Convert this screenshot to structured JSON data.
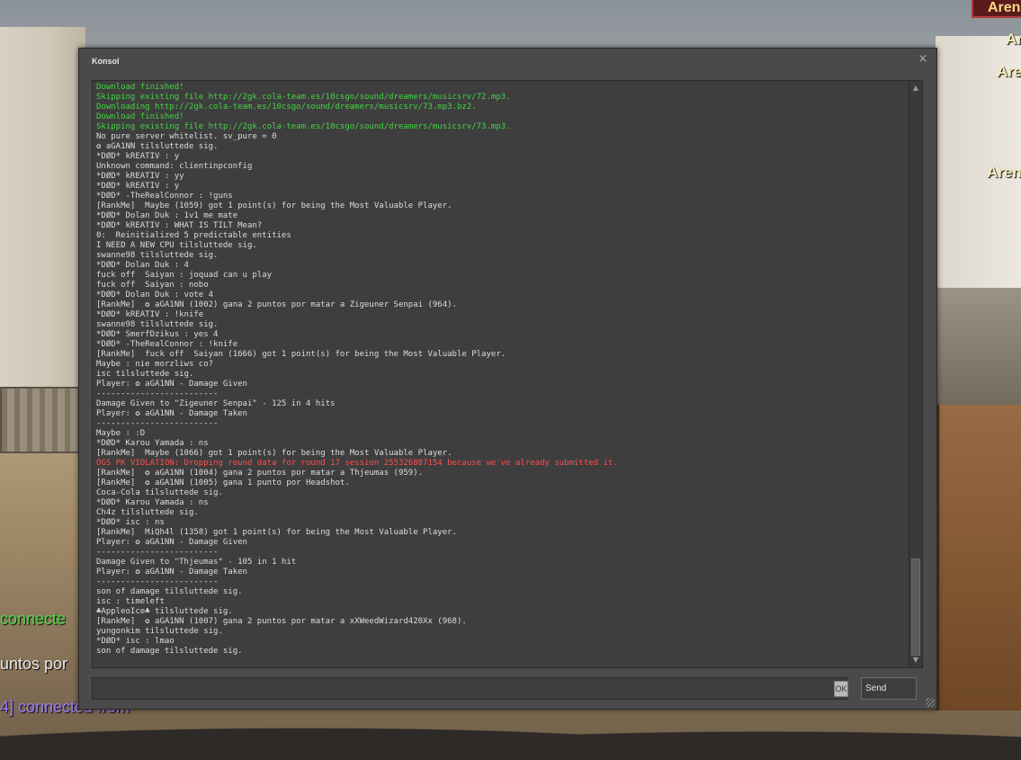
{
  "hud": {
    "top_right": "Arena",
    "arena_labels": [
      "Ar",
      "Are",
      "Aren"
    ],
    "chat": [
      {
        "text": "connecte",
        "color": "#4fd64f"
      },
      {
        "text": "untos por",
        "color": "#e8e8e8"
      },
      {
        "text": "4] connected from",
        "color": "#9b7cff"
      }
    ]
  },
  "window": {
    "title": "Konsol",
    "close_glyph": "×"
  },
  "colors": {
    "normal": "#dcdcdc",
    "download": "#42d642",
    "error": "#ff4d4d"
  },
  "log": [
    {
      "text": "Download finished!",
      "type": "green"
    },
    {
      "text": "Skipping existing file http://2gk.cola-team.es/10csgo/sound/dreamers/musicsrv/72.mp3.",
      "type": "green"
    },
    {
      "text": "Downloading http://2gk.cola-team.es/10csgo/sound/dreamers/musicsrv/73.mp3.bz2.",
      "type": "green"
    },
    {
      "text": "Download finished!",
      "type": "green"
    },
    {
      "text": "Skipping existing file http://2gk.cola-team.es/10csgo/sound/dreamers/musicsrv/73.mp3.",
      "type": "green"
    },
    {
      "text": "No pure server whitelist. sv_pure = 0",
      "type": "white"
    },
    {
      "text": "✪ aGA1NN tilsluttede sig.",
      "type": "white"
    },
    {
      "text": "*DØD* kREATIV : y",
      "type": "white"
    },
    {
      "text": "Unknown command: clientinpconfig",
      "type": "white"
    },
    {
      "text": "*DØD* kREATIV : yy",
      "type": "white"
    },
    {
      "text": "*DØD* kREATIV : y",
      "type": "white"
    },
    {
      "text": "*DØD* -TheRealConnor : !guns",
      "type": "white"
    },
    {
      "text": "[RankMe]  Maybe (1059) got 1 point(s) for being the Most Valuable Player.",
      "type": "white"
    },
    {
      "text": "*DØD* Dolan Duk : 1v1 me mate",
      "type": "white"
    },
    {
      "text": "*DØD* kREATIV : WHAT IS TILT Mean?",
      "type": "white"
    },
    {
      "text": "0:  Reinitialized 5 predictable entities",
      "type": "white"
    },
    {
      "text": "I NEED A NEW CPU tilsluttede sig.",
      "type": "white"
    },
    {
      "text": "swanne98 tilsluttede sig.",
      "type": "white"
    },
    {
      "text": "*DØD* Dolan Duk : 4",
      "type": "white"
    },
    {
      "text": "fuck off  Saiyan : joquad can u play",
      "type": "white"
    },
    {
      "text": "fuck off  Saiyan : nobo",
      "type": "white"
    },
    {
      "text": "*DØD* Dolan Duk : vote 4",
      "type": "white"
    },
    {
      "text": "[RankMe]  ✪ aGA1NN (1002) gana 2 puntos por matar a Zigeuner Senpai (964).",
      "type": "white"
    },
    {
      "text": "*DØD* kREATIV : !knife",
      "type": "white"
    },
    {
      "text": "swanne98 tilsluttede sig.",
      "type": "white"
    },
    {
      "text": "*DØD* SmerfDzikus : yes 4",
      "type": "white"
    },
    {
      "text": "*DØD* -TheRealConnor : !knife",
      "type": "white"
    },
    {
      "text": "[RankMe]  fuck off  Saiyan (1666) got 1 point(s) for being the Most Valuable Player.",
      "type": "white"
    },
    {
      "text": "Maybe : nie morzliws co?",
      "type": "white"
    },
    {
      "text": "isc tilsluttede sig.",
      "type": "white"
    },
    {
      "text": "Player: ✪ aGA1NN - Damage Given",
      "type": "white"
    },
    {
      "text": "-------------------------",
      "type": "white"
    },
    {
      "text": "Damage Given to \"Zigeuner Senpai\" - 125 in 4 hits",
      "type": "white"
    },
    {
      "text": "Player: ✪ aGA1NN - Damage Taken",
      "type": "white"
    },
    {
      "text": "-------------------------",
      "type": "white"
    },
    {
      "text": "Maybe : :D",
      "type": "white"
    },
    {
      "text": "*DØD* Karou Yamada : ns",
      "type": "white"
    },
    {
      "text": "[RankMe]  Maybe (1066) got 1 point(s) for being the Most Valuable Player.",
      "type": "white"
    },
    {
      "text": "OGS PK VIOLATION: Dropping round data for round 17 session 255326887154 because we've already submitted it.",
      "type": "red"
    },
    {
      "text": "[RankMe]  ✪ aGA1NN (1004) gana 2 puntos por matar a Thjeumas (959).",
      "type": "white"
    },
    {
      "text": "[RankMe]  ✪ aGA1NN (1005) gana 1 punto por Headshot.",
      "type": "white"
    },
    {
      "text": "Coca-Cola tilsluttede sig.",
      "type": "white"
    },
    {
      "text": "*DØD* Karou Yamada : ns",
      "type": "white"
    },
    {
      "text": "Ch4z tilsluttede sig.",
      "type": "white"
    },
    {
      "text": "*DØD* isc : ns",
      "type": "white"
    },
    {
      "text": "[RankMe]  MiQh4l (1358) got 1 point(s) for being the Most Valuable Player.",
      "type": "white"
    },
    {
      "text": "Player: ✪ aGA1NN - Damage Given",
      "type": "white"
    },
    {
      "text": "-------------------------",
      "type": "white"
    },
    {
      "text": "Damage Given to \"Thjeumas\" - 105 in 1 hit",
      "type": "white"
    },
    {
      "text": "Player: ✪ aGA1NN - Damage Taken",
      "type": "white"
    },
    {
      "text": "-------------------------",
      "type": "white"
    },
    {
      "text": "son of damage tilsluttede sig.",
      "type": "white"
    },
    {
      "text": "isc : timeleft",
      "type": "white"
    },
    {
      "text": "♣AppleoIce♣ tilsluttede sig.",
      "type": "white"
    },
    {
      "text": "[RankMe]  ✪ aGA1NN (1007) gana 2 puntos por matar a xXWeedWizard420Xx (968).",
      "type": "white"
    },
    {
      "text": "yungonkim tilsluttede sig.",
      "type": "white"
    },
    {
      "text": "*DØD* isc : lmao",
      "type": "white"
    },
    {
      "text": "son of damage tilsluttede sig.",
      "type": "white"
    }
  ],
  "scroll": {
    "up_glyph": "▲",
    "down_glyph": "▼"
  },
  "input": {
    "value": "",
    "placeholder": ""
  },
  "buttons": {
    "ok_label": "OK",
    "send_label": "Send"
  }
}
